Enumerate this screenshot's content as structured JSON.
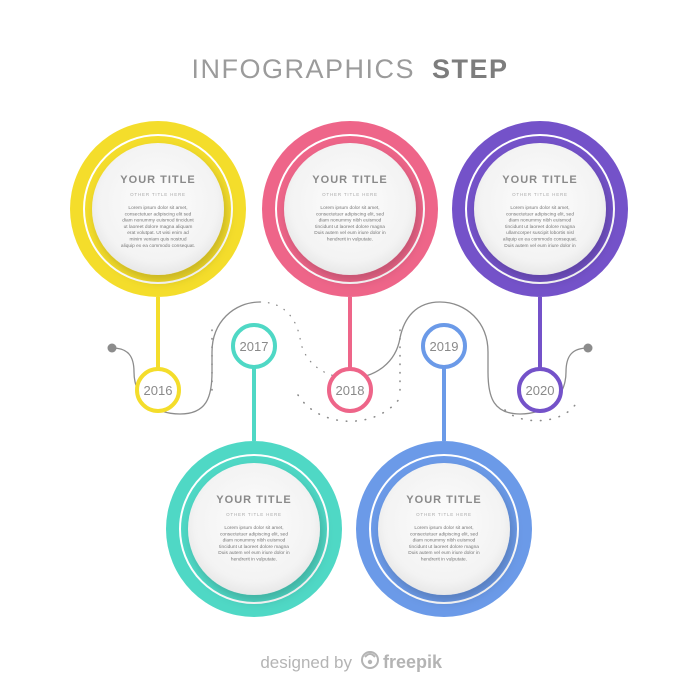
{
  "header": {
    "title_light": "INFOGRAPHICS",
    "title_bold": "STEP"
  },
  "steps": [
    {
      "year": "2016",
      "title": "YOUR TITLE",
      "subtitle": "OTHER TITLE HERE",
      "body": [
        "Lorem ipsum dolor sit amet,",
        "consectetuer adipiscing elit sed",
        "diam nonummy euismod tincidunt",
        "ut laoreet dolore magna aliquam",
        "erat volutpat. Ut wisi enim ad",
        "minim veniam quis nostrud",
        "aliquip ex ea commodo consequat."
      ],
      "color": "#f4dd2b"
    },
    {
      "year": "2017",
      "title": "YOUR TITLE",
      "subtitle": "OTHER TITLE HERE",
      "body": [
        "Lorem ipsum dolor sit amet,",
        "consectetuer adipiscing elit, sed",
        "diam nonummy nibh euismod",
        "tincidunt ut laoreet dolore magna",
        "Duis autem vel eum iriure dolor in",
        "hendrerit in vulputate."
      ],
      "color": "#4fd8c5"
    },
    {
      "year": "2018",
      "title": "YOUR TITLE",
      "subtitle": "OTHER TITLE HERE",
      "body": [
        "Lorem ipsum dolor sit amet,",
        "consectetuer adipiscing elit, sed",
        "diam nonummy nibh euismod",
        "tincidunt ut laoreet dolore magna",
        "Duis autem vel eum iriure dolor in",
        "hendrerit in vulputate."
      ],
      "color": "#ee6589"
    },
    {
      "year": "2019",
      "title": "YOUR TITLE",
      "subtitle": "OTHER TITLE HERE",
      "body": [
        "Lorem ipsum dolor sit amet,",
        "consectetuer adipiscing elit, sed",
        "diam nonummy nibh euismod",
        "tincidunt ut laoreet dolore magna",
        "Duis autem vel eum iriure dolor in",
        "hendrerit in vulputate."
      ],
      "color": "#6b9ae8"
    },
    {
      "year": "2020",
      "title": "YOUR TITLE",
      "subtitle": "OTHER TITLE HERE",
      "body": [
        "Lorem ipsum dolor sit amet,",
        "consectetuer adipiscing elit, sed",
        "diam nonummy nibh euismod",
        "tincidunt ut laoreet dolore magna",
        "ullamcorper suscipit lobortis nisl",
        "aliquip ex ea commodo consequat.",
        "Duis autem vel eum iriure dolor in"
      ],
      "color": "#7452c9"
    }
  ],
  "footer": {
    "designed_by": "designed by",
    "brand": "freepik"
  },
  "colors": {
    "title_gray": "#9b9b9b",
    "line_gray": "#8c8c8c",
    "inner_fill": "#efefef"
  }
}
